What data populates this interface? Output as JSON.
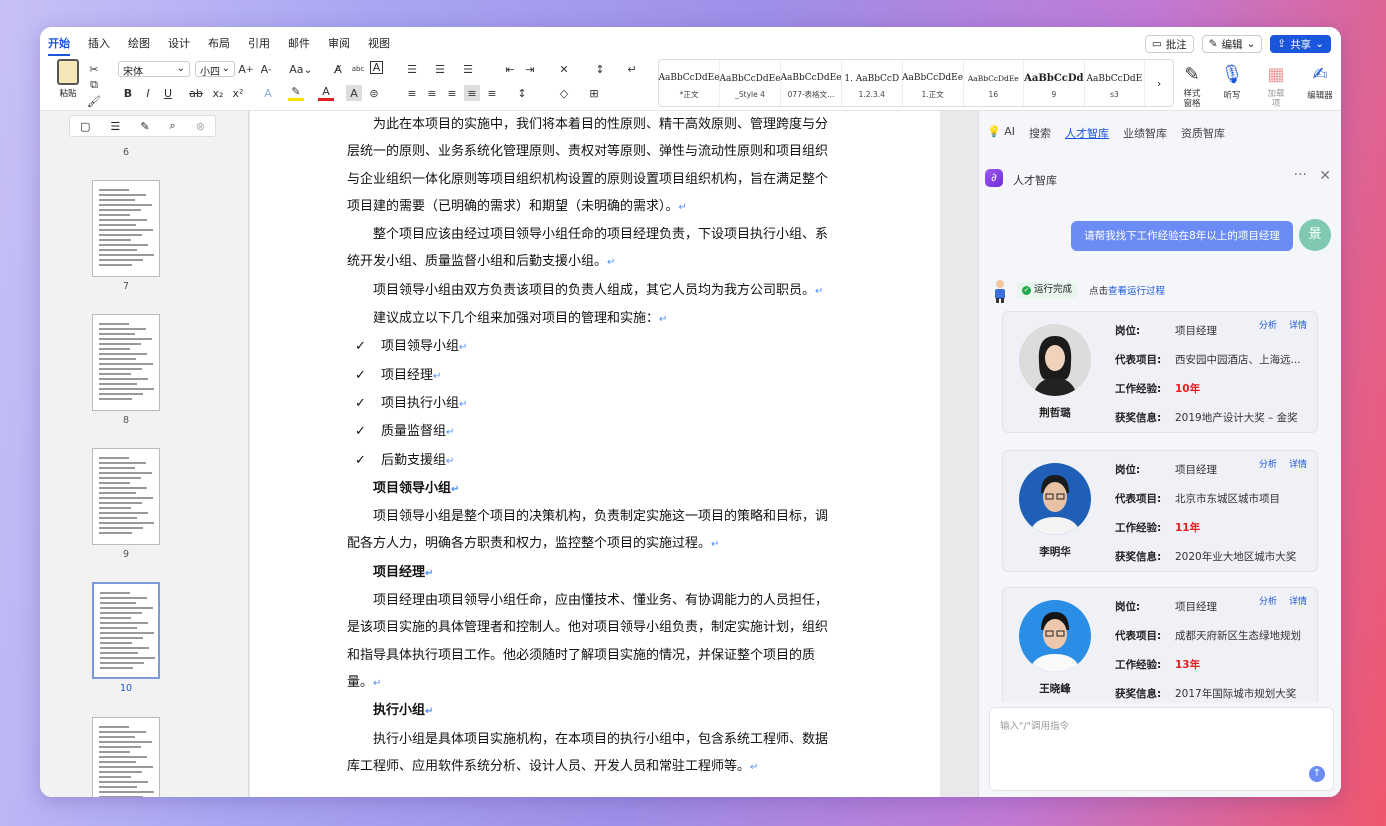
{
  "menu": {
    "items": [
      "开始",
      "插入",
      "绘图",
      "设计",
      "布局",
      "引用",
      "邮件",
      "审阅",
      "视图"
    ],
    "active": "开始"
  },
  "top_buttons": {
    "comment": "批注",
    "edit": "编辑",
    "share": "共享"
  },
  "ribbon": {
    "paste": "粘贴",
    "font_name": "宋体",
    "font_size": "小四",
    "styles": [
      {
        "preview": "AaBbCcDdEe",
        "name": "*正文"
      },
      {
        "preview": "AaBbCcDdEe",
        "name": "_Style 4"
      },
      {
        "preview": "AaBbCcDdEe",
        "name": "077-表格文..."
      },
      {
        "preview": "1.   AaBbCcD",
        "name": "1.2.3.4"
      },
      {
        "preview": "AaBbCcDdEe",
        "name": "1.正文"
      },
      {
        "preview": "AaBbCcDdEe",
        "name": "16"
      },
      {
        "preview": "AaBbCcDd",
        "name": "9"
      },
      {
        "preview": "AaBbCcDdE",
        "name": "s3"
      }
    ],
    "style_pane": "样式\n窗格",
    "dictate": "听写",
    "addins": "加载\n项",
    "editor": "编辑器"
  },
  "thumbnails": {
    "pages": [
      "6",
      "7",
      "8",
      "9",
      "10"
    ],
    "selected": "10"
  },
  "document": {
    "paragraphs": [
      {
        "t": "para",
        "text": "为此在本项目的实施中，我们将本着目的性原则、精干高效原则、管理跨度与分层统一的原则、业务系统化管理原则、责权对等原则、弹性与流动性原则和项目组织与企业组织一体化原则等项目组织机构设置的原则设置项目组织机构，旨在满足整个项目建的需要（已明确的需求）和期望（未明确的需求）。"
      },
      {
        "t": "para",
        "text": "整个项目应该由经过项目领导小组任命的项目经理负责，下设项目执行小组、系统开发小组、质量监督小组和后勤支援小组。"
      },
      {
        "t": "para",
        "text": "项目领导小组由双方负责该项目的负责人组成，其它人员均为我方公司职员。"
      },
      {
        "t": "para",
        "text": "建议成立以下几个组来加强对项目的管理和实施："
      },
      {
        "t": "li",
        "text": "项目领导小组"
      },
      {
        "t": "li",
        "text": "项目经理"
      },
      {
        "t": "li",
        "text": "项目执行小组"
      },
      {
        "t": "li",
        "text": "质量监督组"
      },
      {
        "t": "li",
        "text": "后勤支援组"
      },
      {
        "t": "b",
        "text": "项目领导小组"
      },
      {
        "t": "para",
        "text": "项目领导小组是整个项目的决策机构，负责制定实施这一项目的策略和目标，调配各方人力，明确各方职责和权力，监控整个项目的实施过程。"
      },
      {
        "t": "b",
        "text": "项目经理"
      },
      {
        "t": "para",
        "text": "项目经理由项目领导小组任命，应由懂技术、懂业务、有协调能力的人员担任，是该项目实施的具体管理者和控制人。他对项目领导小组负责，制定实施计划，组织和指导具体执行项目工作。他必须随时了解项目实施的情况，并保证整个项目的质量。"
      },
      {
        "t": "b",
        "text": "执行小组"
      },
      {
        "t": "para",
        "text": "执行小组是具体项目实施机构，在本项目的执行小组中，包含系统工程师、数据库工程师、应用软件系统分析、设计人员、开发人员和常驻工程师等。"
      }
    ],
    "return_mark": "↵",
    "check_mark": "✓"
  },
  "panel": {
    "tabs": [
      "AI",
      "搜索",
      "人才智库",
      "业绩智库",
      "资质智库"
    ],
    "active_tab": "人才智库",
    "header_title": "人才智库",
    "user_message": "请帮我找下工作经验在8年以上的项目经理",
    "user_avatar": "景",
    "status": "运行完成",
    "run_prefix": "点击",
    "run_link": "查看运行过程",
    "card_labels": {
      "position": "岗位:",
      "project": "代表项目:",
      "experience": "工作经验:",
      "award": "获奖信息:"
    },
    "card_actions": [
      "分析",
      "详情"
    ],
    "candidates": [
      {
        "name": "荆哲璐",
        "position": "项目经理",
        "project": "西安园中园酒店、上海远...",
        "experience": "10年",
        "award": "2019地产设计大奖 – 金奖"
      },
      {
        "name": "李明华",
        "position": "项目经理",
        "project": "北京市东城区城市项目",
        "experience": "11年",
        "award": "2020年业大地区城市大奖"
      },
      {
        "name": "王晓峰",
        "position": "项目经理",
        "project": "成都天府新区生态绿地规划",
        "experience": "13年",
        "award": "2017年国际城市规划大奖"
      }
    ],
    "input_placeholder": "输入\"/\"调用指令"
  },
  "colors": {
    "accent": "#1a56db",
    "bubble": "#6b8cf5",
    "highlight_red": "#e02020"
  }
}
